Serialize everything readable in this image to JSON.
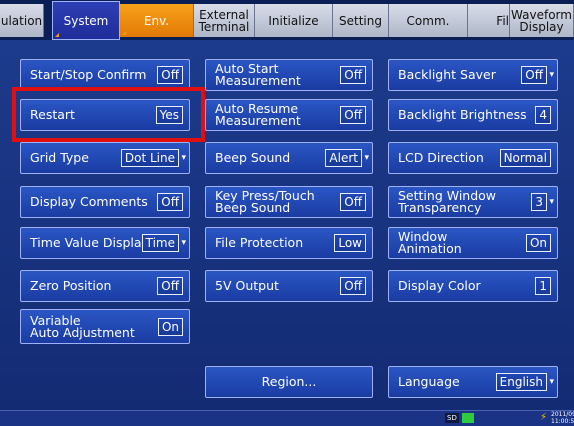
{
  "tabs": [
    {
      "label": "ulation"
    },
    {
      "label": "System"
    },
    {
      "label": "Env."
    },
    {
      "label": "External\nTerminal"
    },
    {
      "label": "Initialize"
    },
    {
      "label": "Setting"
    },
    {
      "label": "Comm."
    },
    {
      "label": "Fil"
    },
    {
      "label": "Waveform\nDisplay"
    }
  ],
  "left": {
    "start_stop_confirm": {
      "label": "Start/Stop Confirm",
      "value": "Off"
    },
    "restart": {
      "label": "Restart",
      "value": "Yes"
    },
    "grid_type": {
      "label": "Grid Type",
      "value": "Dot Line"
    },
    "display_comments": {
      "label": "Display Comments",
      "value": "Off"
    },
    "time_value_display": {
      "label": "Time Value Display",
      "value": "Time"
    },
    "zero_position": {
      "label": "Zero Position",
      "value": "Off"
    },
    "variable_auto_adjust": {
      "label": "Variable\nAuto Adjustment",
      "value": "On"
    }
  },
  "middle": {
    "auto_start": {
      "label": "Auto Start\nMeasurement",
      "value": "Off"
    },
    "auto_resume": {
      "label": "Auto Resume\nMeasurement",
      "value": "Off"
    },
    "beep_sound": {
      "label": "Beep Sound",
      "value": "Alert"
    },
    "key_press": {
      "label": "Key Press/Touch\nBeep Sound",
      "value": "Off"
    },
    "file_protection": {
      "label": "File Protection",
      "value": "Low"
    },
    "five_v_output": {
      "label": "5V Output",
      "value": "Off"
    },
    "region": {
      "label": "Region..."
    }
  },
  "right": {
    "backlight_saver": {
      "label": "Backlight Saver",
      "value": "Off"
    },
    "backlight_brightness": {
      "label": "Backlight Brightness",
      "value": "4"
    },
    "lcd_direction": {
      "label": "LCD Direction",
      "value": "Normal"
    },
    "window_transparency": {
      "label": "Setting Window\nTransparency",
      "value": "3"
    },
    "window_animation": {
      "label": "Window\nAnimation",
      "value": "On"
    },
    "display_color": {
      "label": "Display Color",
      "value": "1"
    },
    "language": {
      "label": "Language",
      "value": "English"
    }
  },
  "status": {
    "sd": "SD",
    "date": "2011/09/05",
    "time": "11:00:59"
  }
}
